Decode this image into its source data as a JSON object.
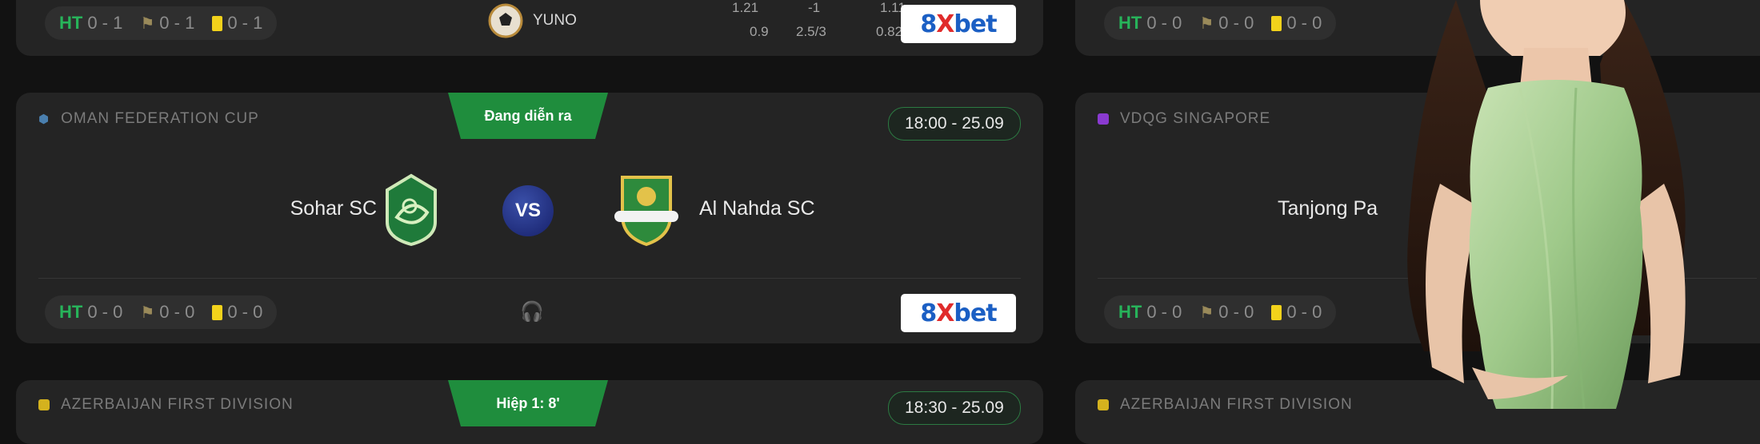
{
  "colors": {
    "accent_green": "#1f8d3d",
    "brand_blue": "#1b5fc4",
    "card_bg": "#242424"
  },
  "top_left": {
    "stats": {
      "ht_label": "HT",
      "ht": "0 - 1",
      "corners": "0 - 1",
      "cards": "0 - 1"
    },
    "team": "YUNO",
    "odds": {
      "r1": [
        "1.21",
        "-1",
        "1.11"
      ],
      "r2": [
        "0.9",
        "2.5/3",
        "0.82"
      ]
    },
    "brand": {
      "a": "8",
      "b": "X",
      "c": "bet"
    }
  },
  "top_right": {
    "stats": {
      "ht_label": "HT",
      "ht": "0 - 0",
      "corners": "0 - 0",
      "cards": "0 - 0"
    }
  },
  "match_left": {
    "league": "OMAN FEDERATION CUP",
    "status": "Đang diễn ra",
    "time": "18:00 - 25.09",
    "home": "Sohar SC",
    "vs": "VS",
    "away": "Al Nahda SC",
    "stats": {
      "ht_label": "HT",
      "ht": "0 - 0",
      "corners": "0 - 0",
      "cards": "0 - 0"
    },
    "brand": {
      "a": "8",
      "b": "X",
      "c": "bet"
    }
  },
  "match_right": {
    "league": "VDQG SINGAPORE",
    "home": "Tanjong Pa",
    "stats": {
      "ht_label": "HT",
      "ht": "0 - 0",
      "corners": "0 - 0",
      "cards": "0 - 0"
    }
  },
  "bottom_left": {
    "league": "AZERBAIJAN FIRST DIVISION",
    "status": "Hiệp 1: 8'",
    "time": "18:30 - 25.09"
  },
  "bottom_right": {
    "league": "AZERBAIJAN FIRST DIVISION"
  }
}
